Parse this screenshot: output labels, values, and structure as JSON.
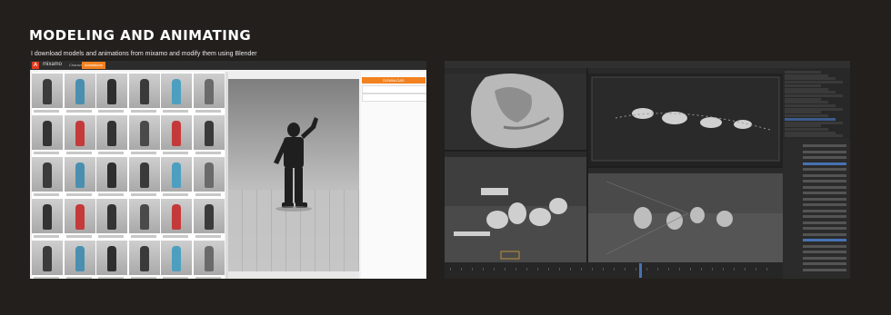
{
  "page": {
    "title": "MODELING AND ANIMATING",
    "subtitle": "I download models and animations from mixamo and modify them using Blender"
  },
  "mixamo": {
    "logo": "A",
    "brand": "mixamo",
    "tabs": [
      {
        "label": "Characters",
        "active": false
      },
      {
        "label": "Animations",
        "active": true
      }
    ],
    "buttons": [
      {
        "label": "DOWNLOAD",
        "primary": true
      },
      {
        "label": "",
        "primary": false
      },
      {
        "label": "",
        "primary": false
      }
    ],
    "accent": "#f2811f",
    "character_icon": "soldier-figure"
  },
  "blender": {
    "accent": "#4772b3",
    "viewports": [
      "sculpt-viewport",
      "camera-viewport",
      "scene-viewport",
      "render-viewport"
    ]
  }
}
